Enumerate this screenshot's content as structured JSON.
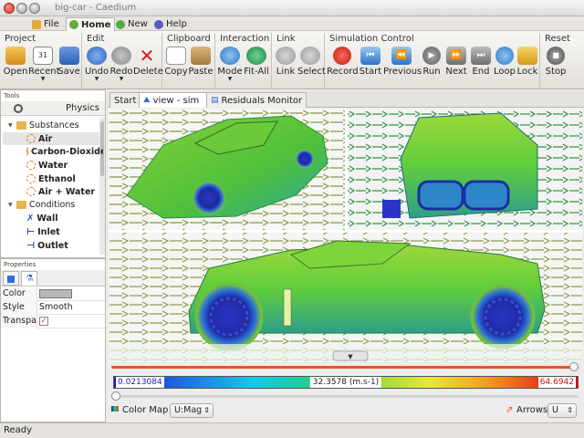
{
  "window": {
    "title": "big-car - Caedium"
  },
  "menu": {
    "tabs": [
      {
        "label": "File"
      },
      {
        "label": "Home"
      },
      {
        "label": "New"
      },
      {
        "label": "Help"
      }
    ]
  },
  "ribbon": {
    "groups": {
      "project": "Project",
      "edit": "Edit",
      "clipboard": "Clipboard",
      "interaction": "Interaction",
      "link": "Link",
      "simulation": "Simulation Control",
      "reset": "Reset"
    },
    "buttons": {
      "open": "Open",
      "recent": "Recent",
      "save": "Save",
      "undo": "Undo",
      "redo": "Redo",
      "delete": "Delete",
      "copy": "Copy",
      "paste": "Paste",
      "mode": "Mode",
      "fitall": "Fit-All",
      "link": "Link",
      "select": "Select",
      "record": "Record",
      "start": "Start",
      "previous": "Previous",
      "run": "Run",
      "next": "Next",
      "end": "End",
      "loop": "Loop",
      "lock": "Lock",
      "stop": "Stop"
    },
    "recent_badge": "31"
  },
  "tools": {
    "title": "Tools",
    "header": "Physics",
    "tree": {
      "substances": "Substances",
      "air": "Air",
      "co2": "Carbon-Dioxide",
      "water": "Water",
      "ethanol": "Ethanol",
      "airwater": "Air + Water",
      "conditions": "Conditions",
      "wall": "Wall",
      "inlet": "Inlet",
      "outlet": "Outlet"
    }
  },
  "properties": {
    "title": "Properties",
    "rows": [
      {
        "key": "Color",
        "value": ""
      },
      {
        "key": "Style",
        "value": "Smooth"
      },
      {
        "key": "Transparent",
        "value": "checked"
      }
    ]
  },
  "doc_tabs": [
    {
      "label": "Start"
    },
    {
      "label": "view - sim"
    },
    {
      "label": "Residuals Monitor"
    }
  ],
  "colormap": {
    "min": "0.0213084",
    "mid": "32.3578 (m.s-1)",
    "max": "64.6942",
    "label": "Color Map",
    "field": "U:Mag",
    "arrows_label": "Arrows",
    "arrows_field": "U",
    "slider_top": 1.0,
    "slider_bottom": 0.0
  },
  "status": {
    "text": "Ready"
  },
  "colors": {
    "accent": "#e9541e",
    "selection": "#e5e5e5"
  }
}
